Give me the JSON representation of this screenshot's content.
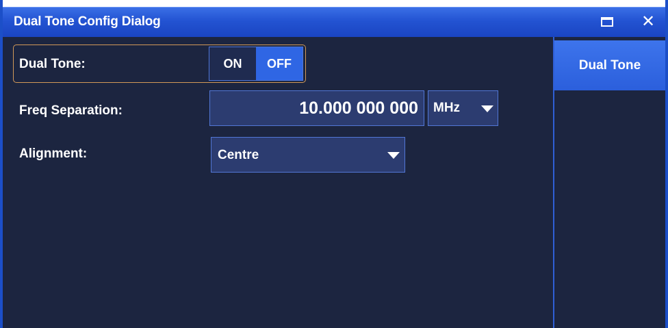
{
  "window": {
    "title": "Dual Tone Config Dialog",
    "maximize_icon": "maximize-icon",
    "close_icon": "close-icon",
    "close_glyph": "✕"
  },
  "form": {
    "dual_tone_label": "Dual Tone:",
    "toggle_on_label": "ON",
    "toggle_off_label": "OFF",
    "toggle_selected": "OFF",
    "freq_separation_label": "Freq Separation:",
    "freq_separation_value": "10.000 000 000",
    "freq_unit_value": "MHz",
    "alignment_label": "Alignment:",
    "alignment_value": "Centre"
  },
  "side_panel": {
    "tabs": [
      {
        "label": "Dual Tone",
        "selected": true
      }
    ]
  },
  "colors": {
    "title_bar": "#2353d2",
    "background": "#1c2540",
    "selected": "#2f66e4",
    "field": "#2c3c70",
    "highlight_border": "#d39a58"
  }
}
